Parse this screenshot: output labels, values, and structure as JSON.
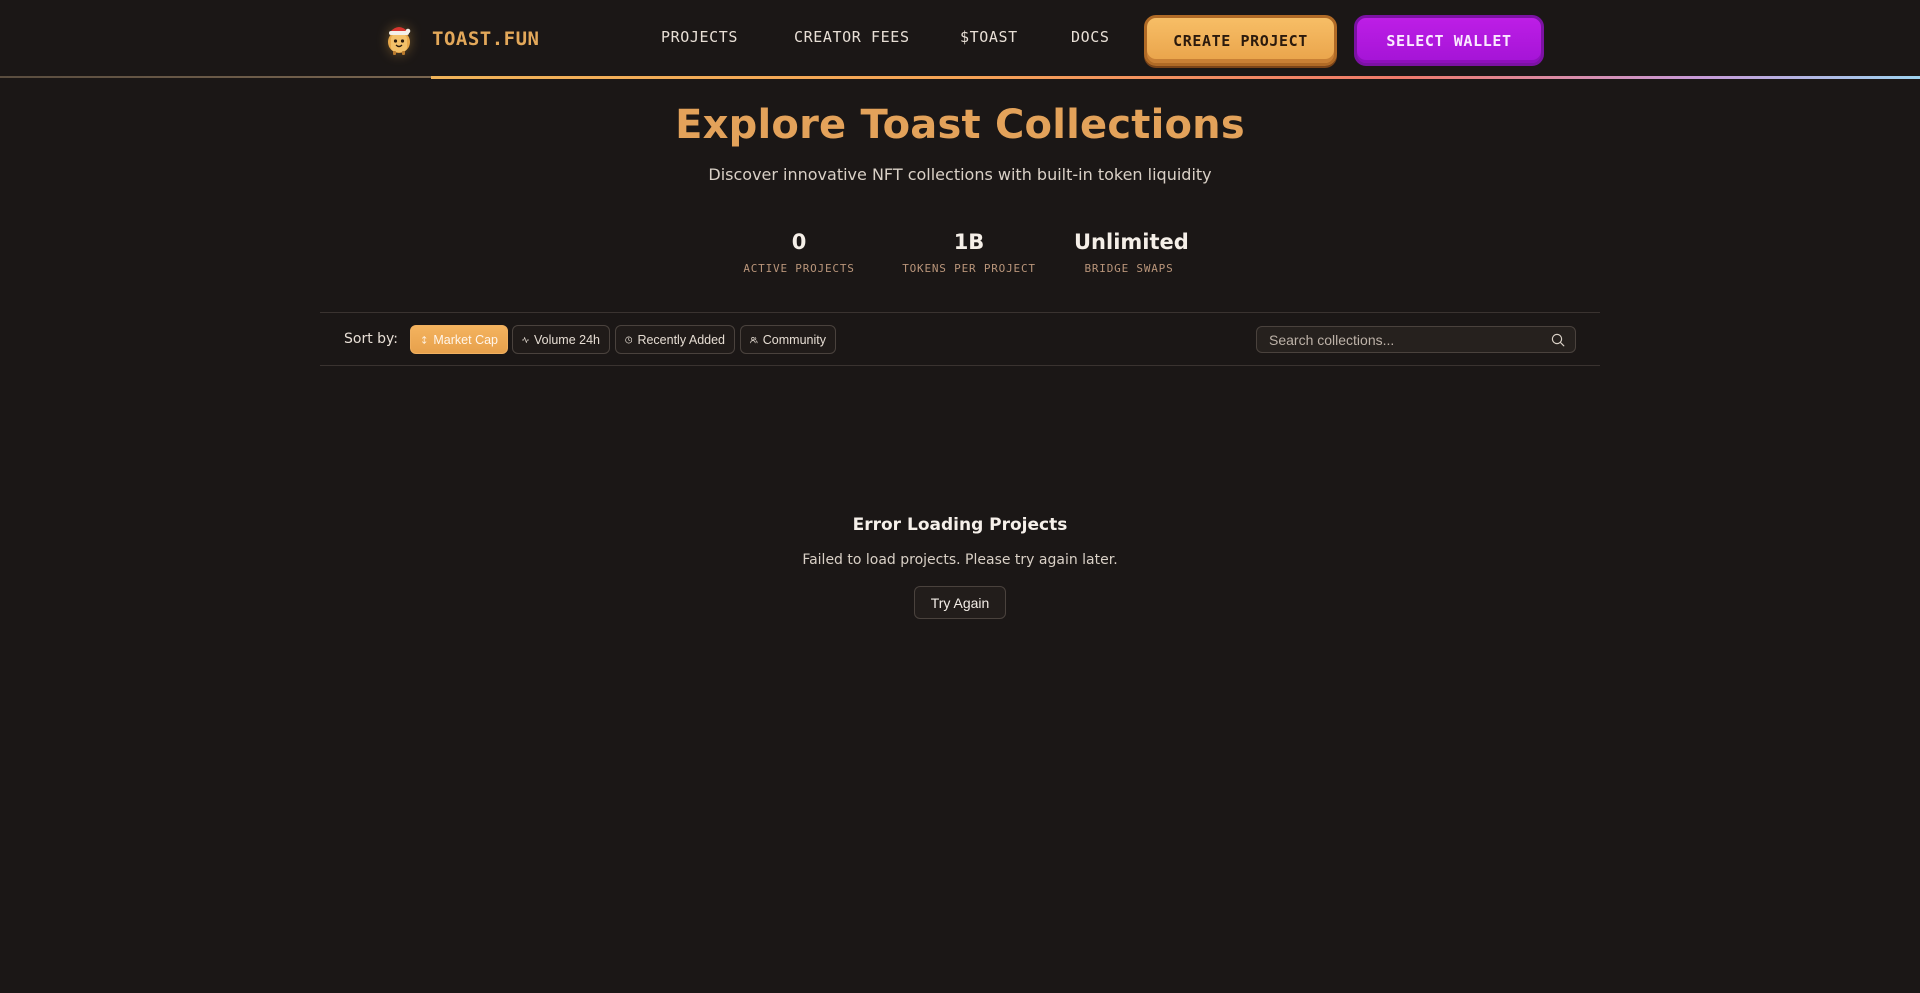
{
  "header": {
    "brand": "TOAST.FUN",
    "logo_icon": "toast-mascot-icon",
    "nav": [
      "PROJECTS",
      "CREATOR FEES",
      "$TOAST",
      "DOCS"
    ],
    "create_label": "CREATE PROJECT",
    "wallet_label": "SELECT WALLET"
  },
  "hero": {
    "title": "Explore Toast Collections",
    "subtitle": "Discover innovative NFT collections with built-in token liquidity"
  },
  "stats": [
    {
      "value": "0",
      "label": "ACTIVE PROJECTS"
    },
    {
      "value": "1B",
      "label": "TOKENS PER PROJECT"
    },
    {
      "value": "Unlimited",
      "label": "BRIDGE SWAPS"
    }
  ],
  "toolbar": {
    "sort_label": "Sort by:",
    "chips": [
      {
        "label": "Market Cap",
        "icon": "arrow-up-down-icon",
        "active": true
      },
      {
        "label": "Volume 24h",
        "icon": "activity-icon",
        "active": false
      },
      {
        "label": "Recently Added",
        "icon": "clock-icon",
        "active": false
      },
      {
        "label": "Community",
        "icon": "users-icon",
        "active": false
      }
    ],
    "search_placeholder": "Search collections..."
  },
  "error": {
    "title": "Error Loading Projects",
    "message": "Failed to load projects. Please try again later.",
    "retry_label": "Try Again"
  },
  "colors": {
    "background": "#1b1716",
    "accent": "#e3a25a",
    "wallet": "#b51ae0"
  }
}
